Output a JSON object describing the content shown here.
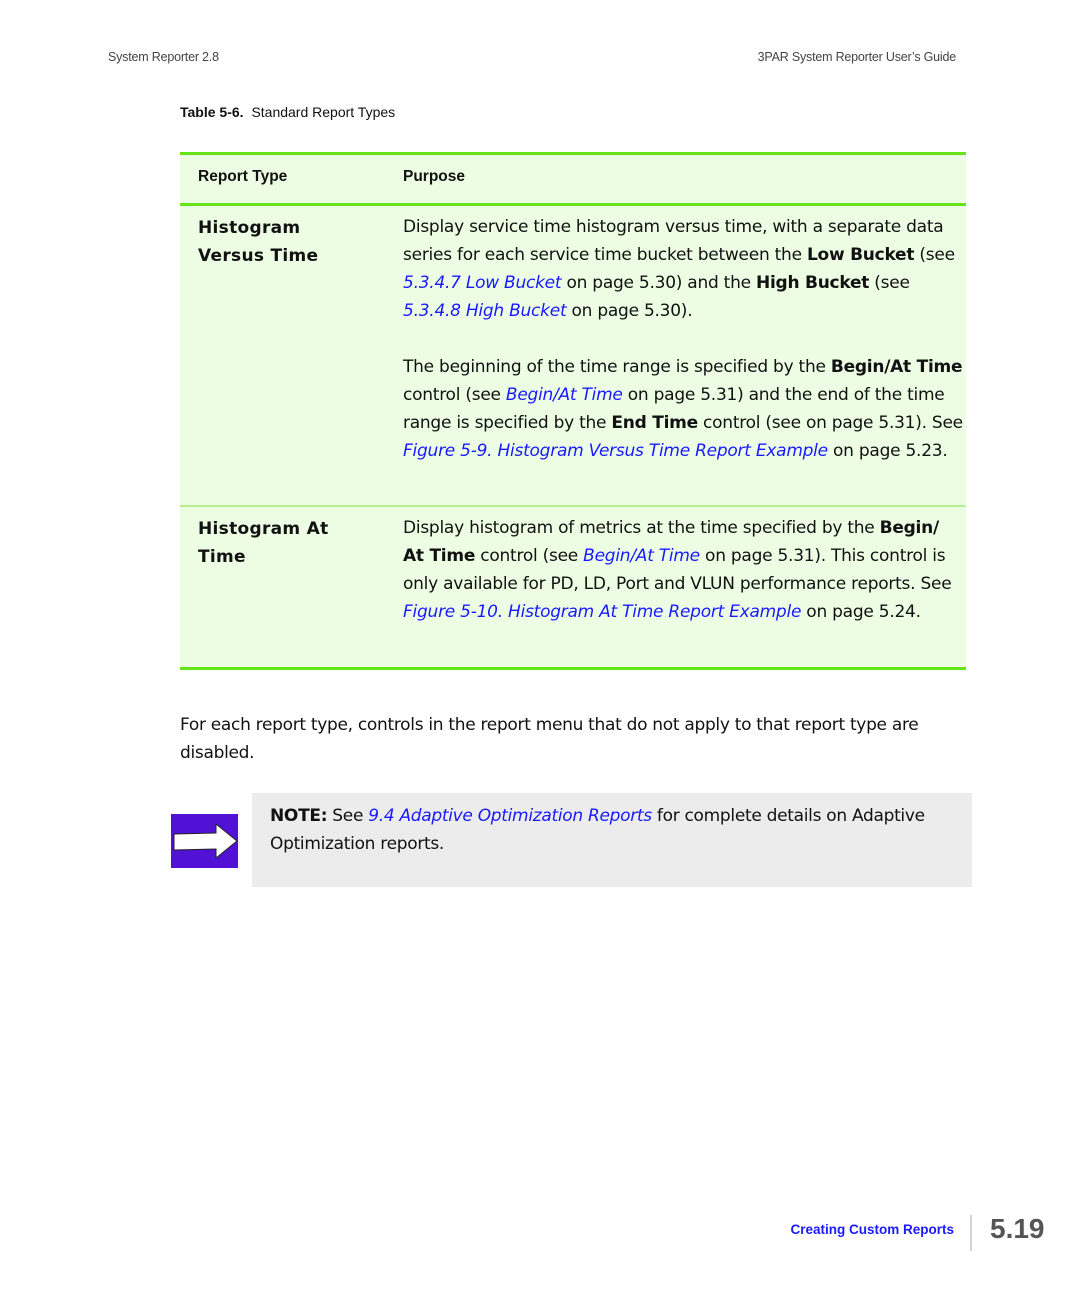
{
  "header": {
    "left": "System Reporter 2.8",
    "right": "3PAR System Reporter User’s Guide"
  },
  "table": {
    "caption_label": "Table 5-6.",
    "caption_title": "Standard Report Types",
    "columns": [
      "Report Type",
      "Purpose"
    ],
    "rows": [
      {
        "type_line1": "Histogram",
        "type_line2": "Versus Time",
        "p1": {
          "t1": "Display service time histogram versus time, with a separate data series for each service time bucket between the ",
          "b1": "Low Bucket",
          "t2": " (see ",
          "l1": "5.3.4.7 Low Bucket",
          "t3": " on page 5.30) and the ",
          "b2": "High Bucket",
          "t4": " (see ",
          "l2": "5.3.4.8 High Bucket",
          "t5": " on page 5.30)."
        },
        "p2": {
          "t1": "The beginning of the time range is specified by the ",
          "b1": "Begin/At Time",
          "t2": " control (see ",
          "l1": "Begin/At Time",
          "t3": " on page 5.31) and the end of the time range is specified by the ",
          "b2": "End Time",
          "t4": " control (see  on page 5.31). See ",
          "l2": "Figure 5-9. Histogram Versus Time Report Example",
          "t5": " on page 5.23."
        }
      },
      {
        "type_line1": "Histogram At",
        "type_line2": "Time",
        "p1": {
          "t1": "Display histogram of metrics at the time specified by the ",
          "b1": "Begin/ At Time",
          "t2": " control (see ",
          "l1": "Begin/At Time",
          "t3": " on page 5.31). This control is only available for PD, LD, Port and VLUN performance reports. See ",
          "l2": "Figure 5-10. Histogram At Time Report Example",
          "t4": " on page 5.24."
        }
      }
    ]
  },
  "body_text": "For each report type, controls in the report menu that do not apply to that report type are disabled.",
  "note": {
    "icon": "arrow-right-icon",
    "label": "NOTE:",
    "t1": " See ",
    "link": "9.4 Adaptive Optimization Reports",
    "t2": " for complete details on Adaptive Optimization reports."
  },
  "footer": {
    "section": "Creating Custom Reports",
    "page": "5.19"
  },
  "colors": {
    "table_bg": "#ecfde3",
    "table_rule": "#66e41a",
    "link": "#1a1aff",
    "note_bg": "#ececec",
    "note_icon_bg": "#5212d6"
  }
}
